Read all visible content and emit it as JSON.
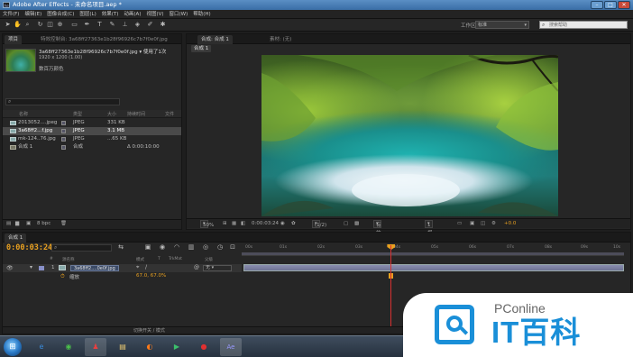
{
  "window": {
    "title": "Adobe After Effects - 未命名项目.aep *",
    "app_icon": "Ae",
    "buttons": {
      "minimize": "–",
      "maximize": "□",
      "close": "✕"
    }
  },
  "menu": [
    "文件(F)",
    "编辑(E)",
    "图像合成(C)",
    "图层(L)",
    "效果(T)",
    "动画(A)",
    "视图(V)",
    "窗口(W)",
    "帮助(H)"
  ],
  "toolbar": {
    "tools": [
      "selection-tool",
      "hand-tool",
      "zoom-tool",
      "rotate-tool",
      "camera-tool",
      "pan-behind-tool",
      "rectangle-tool",
      "pen-tool",
      "type-tool",
      "brush-tool",
      "clone-tool",
      "eraser-tool",
      "roto-tool",
      "puppet-tool"
    ],
    "workspace_label": "工作区:",
    "workspace_value": "标准",
    "help_search_placeholder": "搜索帮助"
  },
  "project": {
    "tab_label": "项目",
    "effect_tab_label": "特效控制台: 3a68ff27363e1b28f96926c7b7f0e0f.jpg",
    "file_name": "3a68ff27363e1b28f96926c7b7f0e0f.jpg ▾ 使用了1次",
    "dimensions": "1920 x 1200 (1.00)",
    "color": "数百万颜色",
    "columns": [
      "名称",
      "",
      "类型",
      "大小",
      "持续时间",
      "文件"
    ],
    "items": [
      {
        "name": "2013052....jpeg",
        "type": "JPEG",
        "size": "331 KB",
        "duration": "",
        "icon": "image-file-icon",
        "selected": false
      },
      {
        "name": "3a68ff2...f.jpg",
        "type": "JPEG",
        "size": "3.1 MB",
        "duration": "",
        "icon": "image-file-icon",
        "selected": true
      },
      {
        "name": "mk-124..76.jpg",
        "type": "JPEG",
        "size": "...65 KB",
        "duration": "",
        "icon": "image-file-icon",
        "selected": false
      },
      {
        "name": "合成 1",
        "type": "合成",
        "size": "",
        "duration": "Δ 0:00:10:00",
        "icon": "composition-icon",
        "selected": false
      }
    ],
    "bpc": "8 bpc"
  },
  "composition": {
    "tab_label": "合成: 合成 1",
    "layer_tab_label": "素材: (无)",
    "subtab": "合成 1",
    "zoom": "50%",
    "timecode": "0:00:03:24",
    "resolution": "(1/2)",
    "camera": "有效摄像机",
    "views": "1 视图",
    "exposure": "+0.0"
  },
  "timeline": {
    "tab_label": "合成 1",
    "timecode": "0:00:03:24",
    "columns": [
      "#",
      "源名称",
      "模式",
      "T",
      "TrkMat",
      "父级"
    ],
    "ruler": [
      "00s",
      "01s",
      "02s",
      "03s",
      "04s",
      "05s",
      "06s",
      "07s",
      "08s",
      "09s",
      "10s"
    ],
    "layer": {
      "index": "1",
      "name": "3a68ff2....0e0f.jpg",
      "parent": "无"
    },
    "property": {
      "name": "缩放",
      "value": "67.0, 67.0%"
    },
    "bottom_label": "切换开关 / 模式",
    "playhead_fraction": 0.39
  },
  "taskbar": {
    "items": [
      {
        "name": "ie-icon",
        "glyph": "e",
        "color": "#3a8ad8"
      },
      {
        "name": "360-browser-icon",
        "glyph": "◉",
        "color": "#4bbf4b"
      },
      {
        "name": "qq-icon",
        "glyph": "♟",
        "color": "#e84040"
      },
      {
        "name": "file-explorer-icon",
        "glyph": "▤",
        "color": "#e8c870"
      },
      {
        "name": "firefox-icon",
        "glyph": "◐",
        "color": "#ff7a18"
      },
      {
        "name": "media-player-icon",
        "glyph": "▶",
        "color": "#3bbf6b"
      },
      {
        "name": "record-icon",
        "glyph": "●",
        "color": "#e03030"
      },
      {
        "name": "after-effects-icon",
        "glyph": "Ae",
        "color": "#9999ff"
      }
    ]
  },
  "watermark": {
    "brand_small": "PConline",
    "brand_big": "IT百科"
  }
}
